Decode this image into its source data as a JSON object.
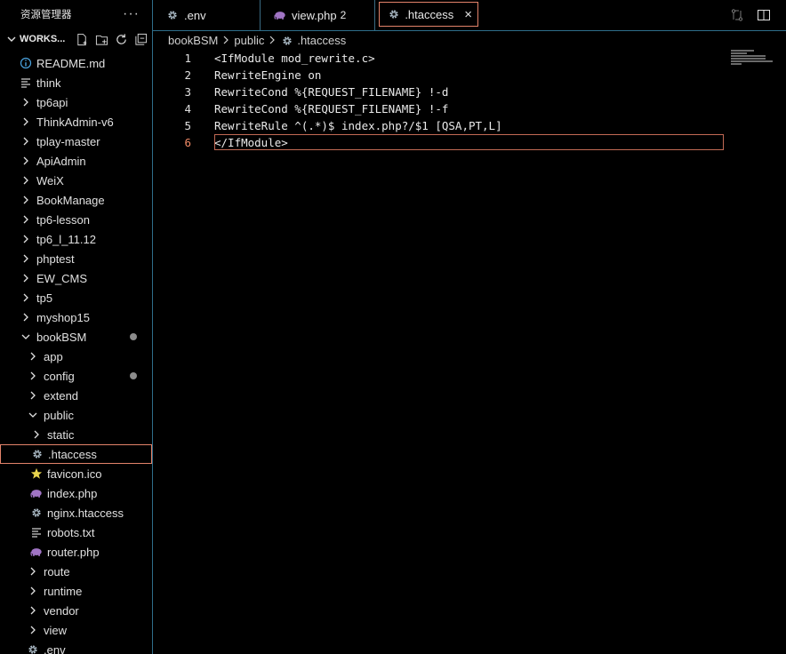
{
  "sidebar": {
    "title": "资源管理器",
    "more_label": "···",
    "workspace": "WORKS...",
    "items": [
      {
        "label": "README.md",
        "icon": "info-icon",
        "level": 0,
        "kind": "file"
      },
      {
        "label": "think",
        "icon": "lines-icon",
        "level": 0,
        "kind": "file"
      },
      {
        "label": "tp6api",
        "icon": "chevron-right-icon",
        "level": 0,
        "kind": "folder"
      },
      {
        "label": "ThinkAdmin-v6",
        "icon": "chevron-right-icon",
        "level": 0,
        "kind": "folder"
      },
      {
        "label": "tplay-master",
        "icon": "chevron-right-icon",
        "level": 0,
        "kind": "folder"
      },
      {
        "label": "ApiAdmin",
        "icon": "chevron-right-icon",
        "level": 0,
        "kind": "folder"
      },
      {
        "label": "WeiX",
        "icon": "chevron-right-icon",
        "level": 0,
        "kind": "folder"
      },
      {
        "label": "BookManage",
        "icon": "chevron-right-icon",
        "level": 0,
        "kind": "folder"
      },
      {
        "label": "tp6-lesson",
        "icon": "chevron-right-icon",
        "level": 0,
        "kind": "folder"
      },
      {
        "label": "tp6_l_11.12",
        "icon": "chevron-right-icon",
        "level": 0,
        "kind": "folder"
      },
      {
        "label": "phptest",
        "icon": "chevron-right-icon",
        "level": 0,
        "kind": "folder"
      },
      {
        "label": "EW_CMS",
        "icon": "chevron-right-icon",
        "level": 0,
        "kind": "folder"
      },
      {
        "label": "tp5",
        "icon": "chevron-right-icon",
        "level": 0,
        "kind": "folder"
      },
      {
        "label": "myshop15",
        "icon": "chevron-right-icon",
        "level": 0,
        "kind": "folder"
      },
      {
        "label": "bookBSM",
        "icon": "chevron-down-icon",
        "level": 0,
        "kind": "folder",
        "modified": true
      },
      {
        "label": "app",
        "icon": "chevron-right-icon",
        "level": 1,
        "kind": "folder"
      },
      {
        "label": "config",
        "icon": "chevron-right-icon",
        "level": 1,
        "kind": "folder",
        "modified": true
      },
      {
        "label": "extend",
        "icon": "chevron-right-icon",
        "level": 1,
        "kind": "folder"
      },
      {
        "label": "public",
        "icon": "chevron-down-icon",
        "level": 1,
        "kind": "folder"
      },
      {
        "label": "static",
        "icon": "chevron-right-icon",
        "level": 2,
        "kind": "folder"
      },
      {
        "label": ".htaccess",
        "icon": "gear-icon",
        "level": 3,
        "kind": "file",
        "selected": true
      },
      {
        "label": "favicon.ico",
        "icon": "star-icon",
        "level": 3,
        "kind": "file"
      },
      {
        "label": "index.php",
        "icon": "php-elephant-icon",
        "level": 3,
        "kind": "file"
      },
      {
        "label": "nginx.htaccess",
        "icon": "gear-icon",
        "level": 3,
        "kind": "file"
      },
      {
        "label": "robots.txt",
        "icon": "lines-icon",
        "level": 3,
        "kind": "file"
      },
      {
        "label": "router.php",
        "icon": "php-elephant-icon",
        "level": 3,
        "kind": "file"
      },
      {
        "label": "route",
        "icon": "chevron-right-icon",
        "level": 1,
        "kind": "folder"
      },
      {
        "label": "runtime",
        "icon": "chevron-right-icon",
        "level": 1,
        "kind": "folder"
      },
      {
        "label": "vendor",
        "icon": "chevron-right-icon",
        "level": 1,
        "kind": "folder"
      },
      {
        "label": "view",
        "icon": "chevron-right-icon",
        "level": 1,
        "kind": "folder"
      },
      {
        "label": ".env",
        "icon": "gear-icon",
        "level": 1,
        "kind": "file"
      }
    ]
  },
  "tabs": [
    {
      "label": ".env",
      "icon": "gear-icon",
      "badge": "",
      "active": false
    },
    {
      "label": "view.php",
      "icon": "php-elephant-icon",
      "badge": "2",
      "active": false
    },
    {
      "label": ".htaccess",
      "icon": "gear-icon",
      "badge": "",
      "active": true,
      "close": "×"
    }
  ],
  "breadcrumb": [
    "bookBSM",
    "public",
    ".htaccess"
  ],
  "editor": {
    "current_line": 6,
    "lines": [
      "<IfModule mod_rewrite.c>",
      "RewriteEngine on",
      "RewriteCond %{REQUEST_FILENAME} !-d",
      "RewriteCond %{REQUEST_FILENAME} !-f",
      "RewriteRule ^(.*)$ index.php?/$1 [QSA,PT,L]",
      "</IfModule>"
    ]
  },
  "colors": {
    "accent": "#e3836a",
    "border": "#2f6e8a",
    "php_icon": "#a074c4",
    "star_icon": "#e8d44d",
    "info_icon": "#4aa3df",
    "gear_icon": "#a9b8c3"
  }
}
